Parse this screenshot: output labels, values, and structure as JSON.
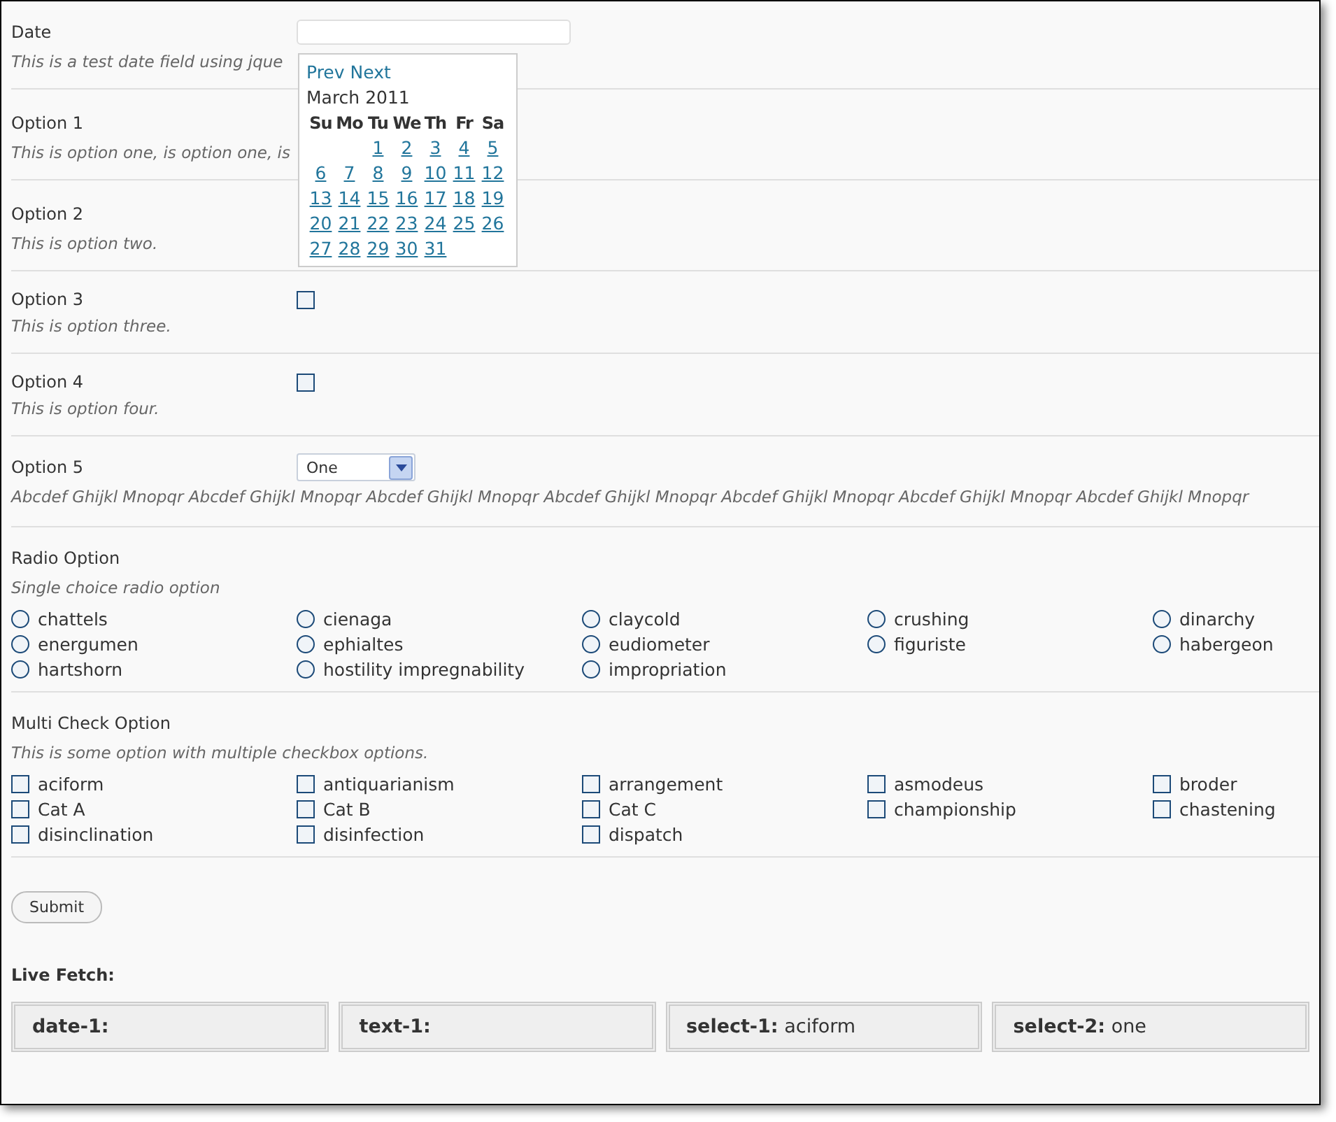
{
  "fields": [
    {
      "kind": "date",
      "label": "Date",
      "description": "This is a test date field using jque"
    },
    {
      "kind": "plain",
      "label": "Option 1",
      "description": "This is option one, is option one, is"
    },
    {
      "kind": "plain",
      "label": "Option 2",
      "description": "This is option two."
    },
    {
      "kind": "checkbox",
      "label": "Option 3",
      "description": "This is option three.",
      "checked": false
    },
    {
      "kind": "checkbox",
      "label": "Option 4",
      "description": "This is option four.",
      "checked": false
    },
    {
      "kind": "select",
      "label": "Option 5",
      "value": "One",
      "description": "Abcdef Ghijkl Mnopqr Abcdef Ghijkl Mnopqr Abcdef Ghijkl Mnopqr Abcdef Ghijkl Mnopqr Abcdef Ghijkl Mnopqr Abcdef Ghijkl Mnopqr Abcdef Ghijkl Mnopqr"
    },
    {
      "kind": "radio",
      "label": "Radio Option",
      "description": "Single choice radio option",
      "options": [
        {
          "label": "chattels",
          "selected": false
        },
        {
          "label": "cienaga",
          "selected": false
        },
        {
          "label": "claycold",
          "selected": false
        },
        {
          "label": "crushing",
          "selected": false
        },
        {
          "label": "dinarchy",
          "selected": false
        },
        {
          "label": "energumen",
          "selected": false
        },
        {
          "label": "ephialtes",
          "selected": false
        },
        {
          "label": "eudiometer",
          "selected": false
        },
        {
          "label": "figuriste",
          "selected": false
        },
        {
          "label": "habergeon",
          "selected": false
        },
        {
          "label": "hartshorn",
          "selected": false
        },
        {
          "label": "hostility impregnability",
          "selected": false
        },
        {
          "label": "impropriation",
          "selected": false
        }
      ]
    },
    {
      "kind": "multicheck",
      "label": "Multi Check Option",
      "description": "This is some option with multiple checkbox options.",
      "options": [
        {
          "label": "aciform",
          "checked": false
        },
        {
          "label": "antiquarianism",
          "checked": false
        },
        {
          "label": "arrangement",
          "checked": false
        },
        {
          "label": "asmodeus",
          "checked": false
        },
        {
          "label": "broder",
          "checked": false
        },
        {
          "label": "Cat A",
          "checked": false
        },
        {
          "label": "Cat B",
          "checked": false
        },
        {
          "label": "Cat C",
          "checked": false
        },
        {
          "label": "championship",
          "checked": false
        },
        {
          "label": "chastening",
          "checked": false
        },
        {
          "label": "disinclination",
          "checked": false
        },
        {
          "label": "disinfection",
          "checked": false
        },
        {
          "label": "dispatch",
          "checked": false
        }
      ]
    }
  ],
  "datepicker": {
    "prev": "Prev",
    "next": "Next",
    "month": "March 2011",
    "weekdays": [
      "Su",
      "Mo",
      "Tu",
      "We",
      "Th",
      "Fr",
      "Sa"
    ],
    "weeks": [
      [
        "1",
        "2",
        "3",
        "4",
        "5"
      ],
      [
        "6",
        "7",
        "8",
        "9",
        "10",
        "11",
        "12"
      ],
      [
        "13",
        "14",
        "15",
        "16",
        "17",
        "18",
        "19"
      ],
      [
        "20",
        "21",
        "22",
        "23",
        "24",
        "25",
        "26"
      ],
      [
        "27",
        "28",
        "29",
        "30",
        "31"
      ]
    ]
  },
  "submit": "Submit",
  "live_fetch": {
    "title": "Live Fetch:",
    "items": [
      {
        "key": "date-1:"
      },
      {
        "key": "text-1:"
      },
      {
        "key": "select-1:",
        "value": "aciform"
      },
      {
        "key": "select-2:",
        "value": "one"
      }
    ]
  }
}
